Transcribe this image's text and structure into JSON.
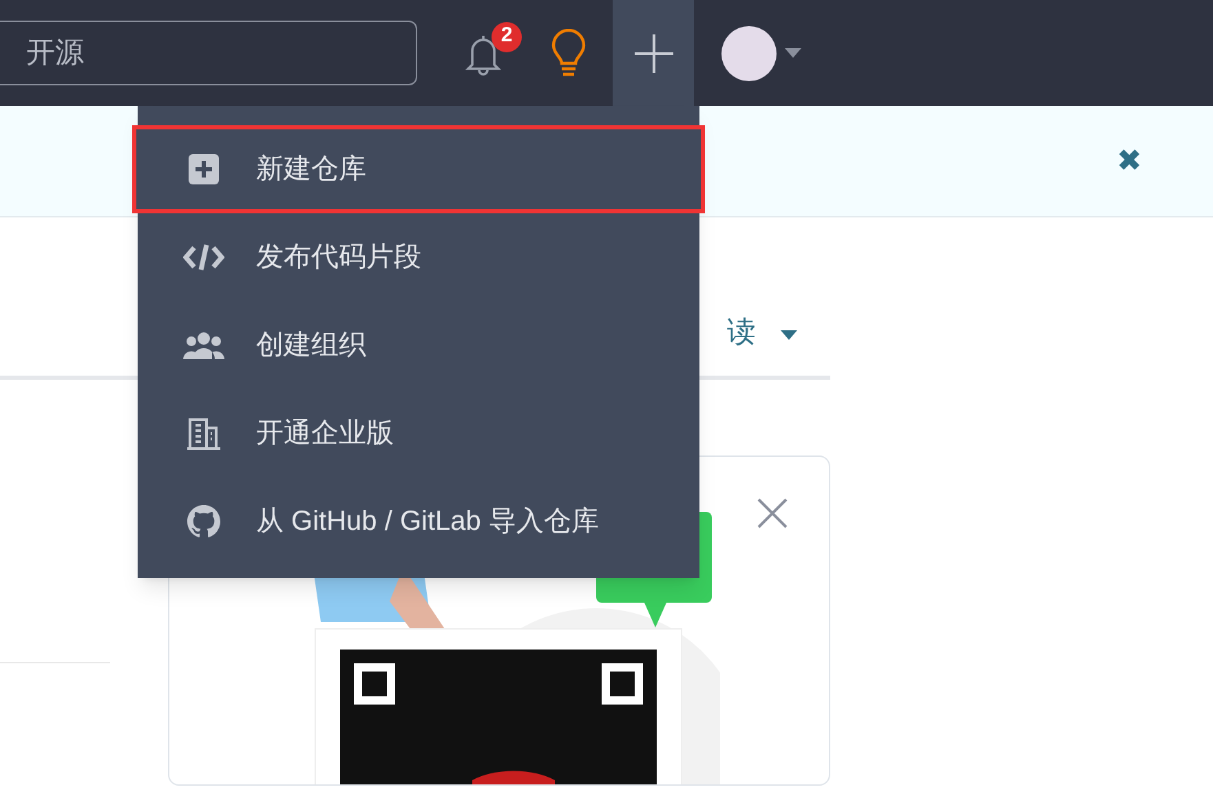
{
  "header": {
    "search": {
      "placeholder": "开源"
    },
    "notifications": {
      "badge": "2"
    }
  },
  "banner": {
    "close": "✖"
  },
  "tabs": {
    "label": "读"
  },
  "menu": {
    "items": [
      {
        "kind": "new-repo",
        "label": "新建仓库",
        "selected": true
      },
      {
        "kind": "code",
        "label": "发布代码片段",
        "selected": false
      },
      {
        "kind": "group",
        "label": "创建组织",
        "selected": false
      },
      {
        "kind": "building",
        "label": "开通企业版",
        "selected": false
      },
      {
        "kind": "github",
        "label": "从 GitHub / GitLab 导入仓库",
        "selected": false
      }
    ]
  }
}
